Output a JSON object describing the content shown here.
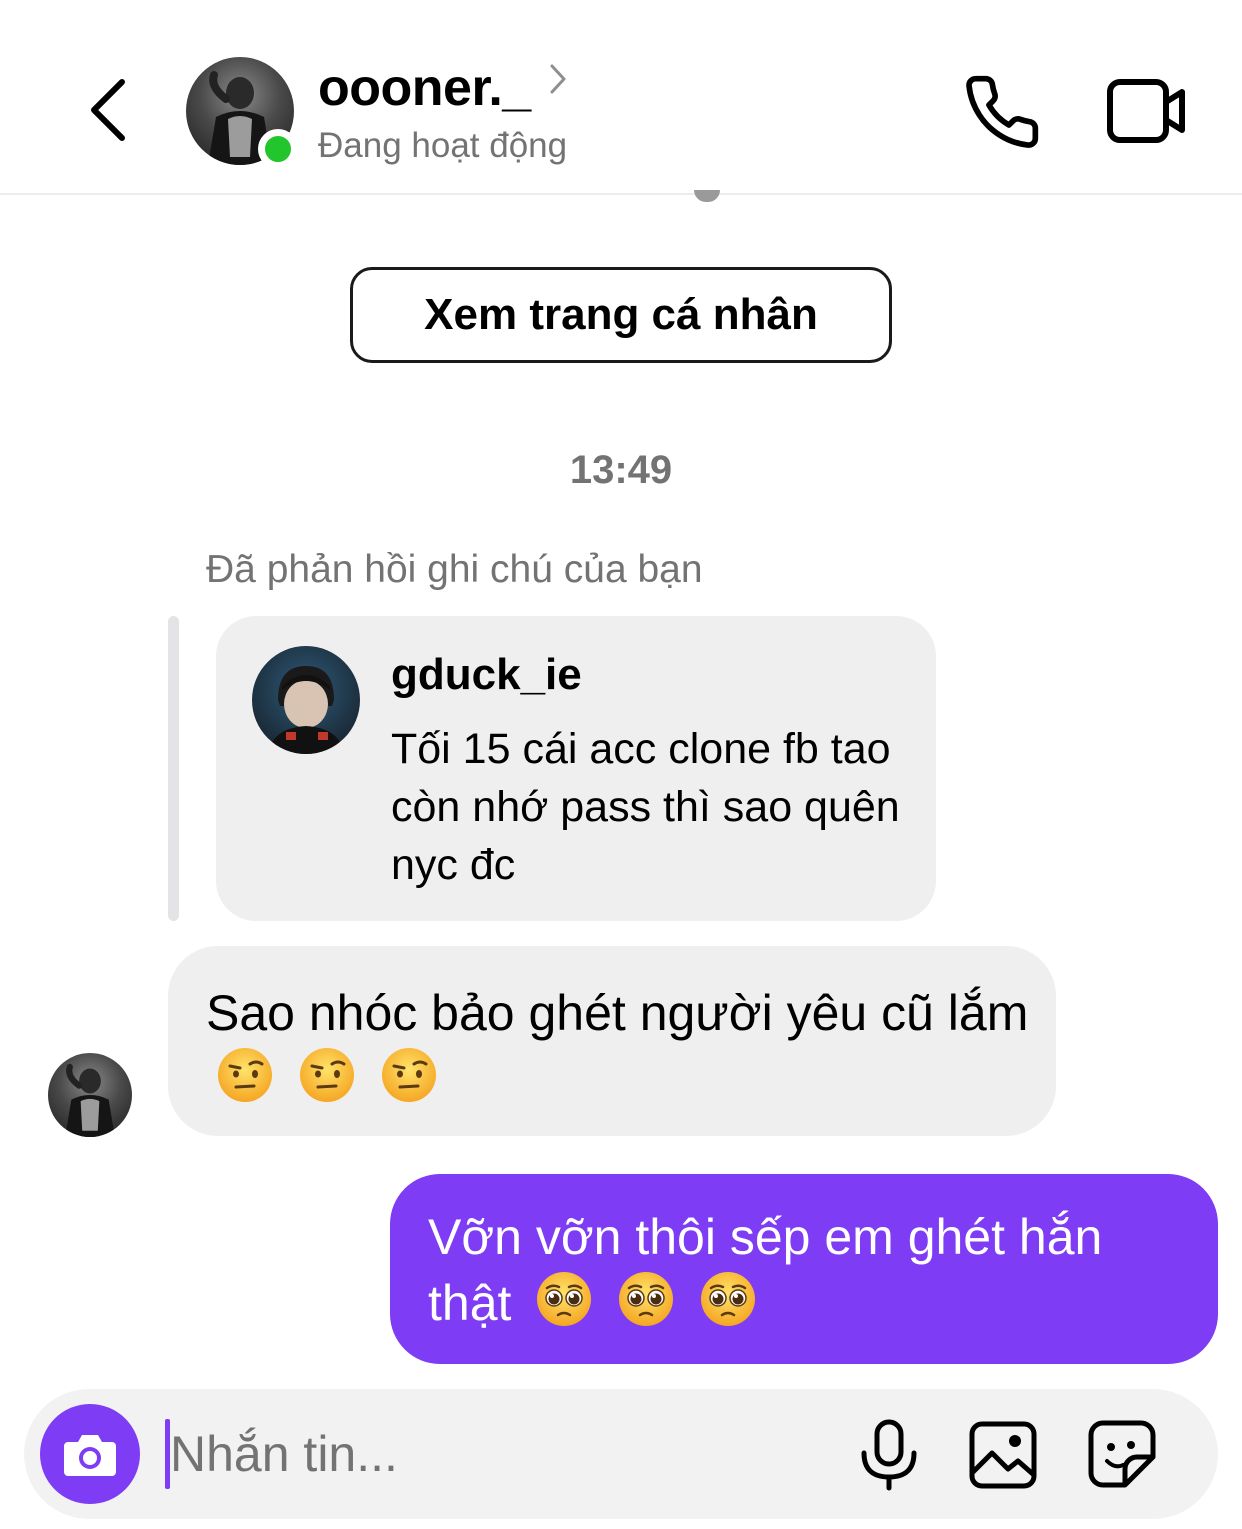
{
  "header": {
    "username": "oooner._",
    "status": "Đang hoạt động"
  },
  "profile_button": {
    "label": "Xem trang cá nhân"
  },
  "timestamp": "13:49",
  "reply": {
    "label": "Đã phản hồi ghi chú của bạn",
    "note_username": "gduck_ie",
    "note_text": "Tối 15 cái acc clone fb tao còn nhớ pass thì sao quên nyc đc"
  },
  "messages": [
    {
      "direction": "incoming",
      "text": "Sao nhóc bảo ghét người yêu cũ lắm",
      "emojis": [
        "raised-eyebrow-emoji",
        "raised-eyebrow-emoji",
        "raised-eyebrow-emoji"
      ]
    },
    {
      "direction": "outgoing",
      "text": "Vỡn vỡn thôi sếp em ghét hắn thật",
      "emojis": [
        "pleading-face-emoji",
        "pleading-face-emoji",
        "pleading-face-emoji"
      ]
    }
  ],
  "composer": {
    "placeholder": "Nhắn tin..."
  },
  "colors": {
    "accent": "#7f3cf5",
    "online": "#22c52b",
    "bubble_incoming": "#efefef",
    "secondary_text": "#737373"
  },
  "icons": [
    "back-icon",
    "chevron-right-icon",
    "phone-icon",
    "video-camera-icon",
    "camera-icon",
    "microphone-icon",
    "gallery-icon",
    "sticker-icon"
  ]
}
